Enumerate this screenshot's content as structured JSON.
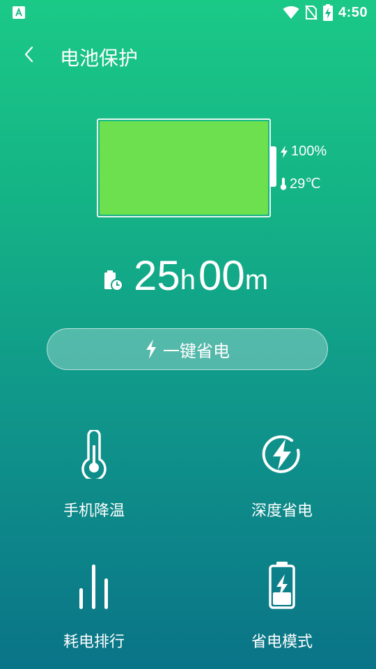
{
  "status_bar": {
    "time": "4:50",
    "icons": [
      "accessibility-icon",
      "wifi-icon",
      "no-sim-icon",
      "battery-charging-icon"
    ]
  },
  "header": {
    "back_icon": "chevron-left-icon",
    "title": "电池保护"
  },
  "battery": {
    "level_fraction": 1.0,
    "level_text": "100%",
    "temperature_text": "29℃",
    "fill_color": "#6ce04f"
  },
  "remaining_time": {
    "hours": "25",
    "hours_unit": "h",
    "minutes": "00",
    "minutes_unit": "m"
  },
  "one_key_save": {
    "label": "一键省电"
  },
  "features": [
    {
      "label": "手机降温",
      "icon": "thermometer-icon"
    },
    {
      "label": "深度省电",
      "icon": "lightning-circle-icon"
    },
    {
      "label": "耗电排行",
      "icon": "bar-ranking-icon"
    },
    {
      "label": "省电模式",
      "icon": "battery-saver-icon"
    }
  ],
  "colors": {
    "gradient_top": "#1bc987",
    "gradient_bottom": "#0a7488",
    "battery_fill": "#6ce04f"
  }
}
